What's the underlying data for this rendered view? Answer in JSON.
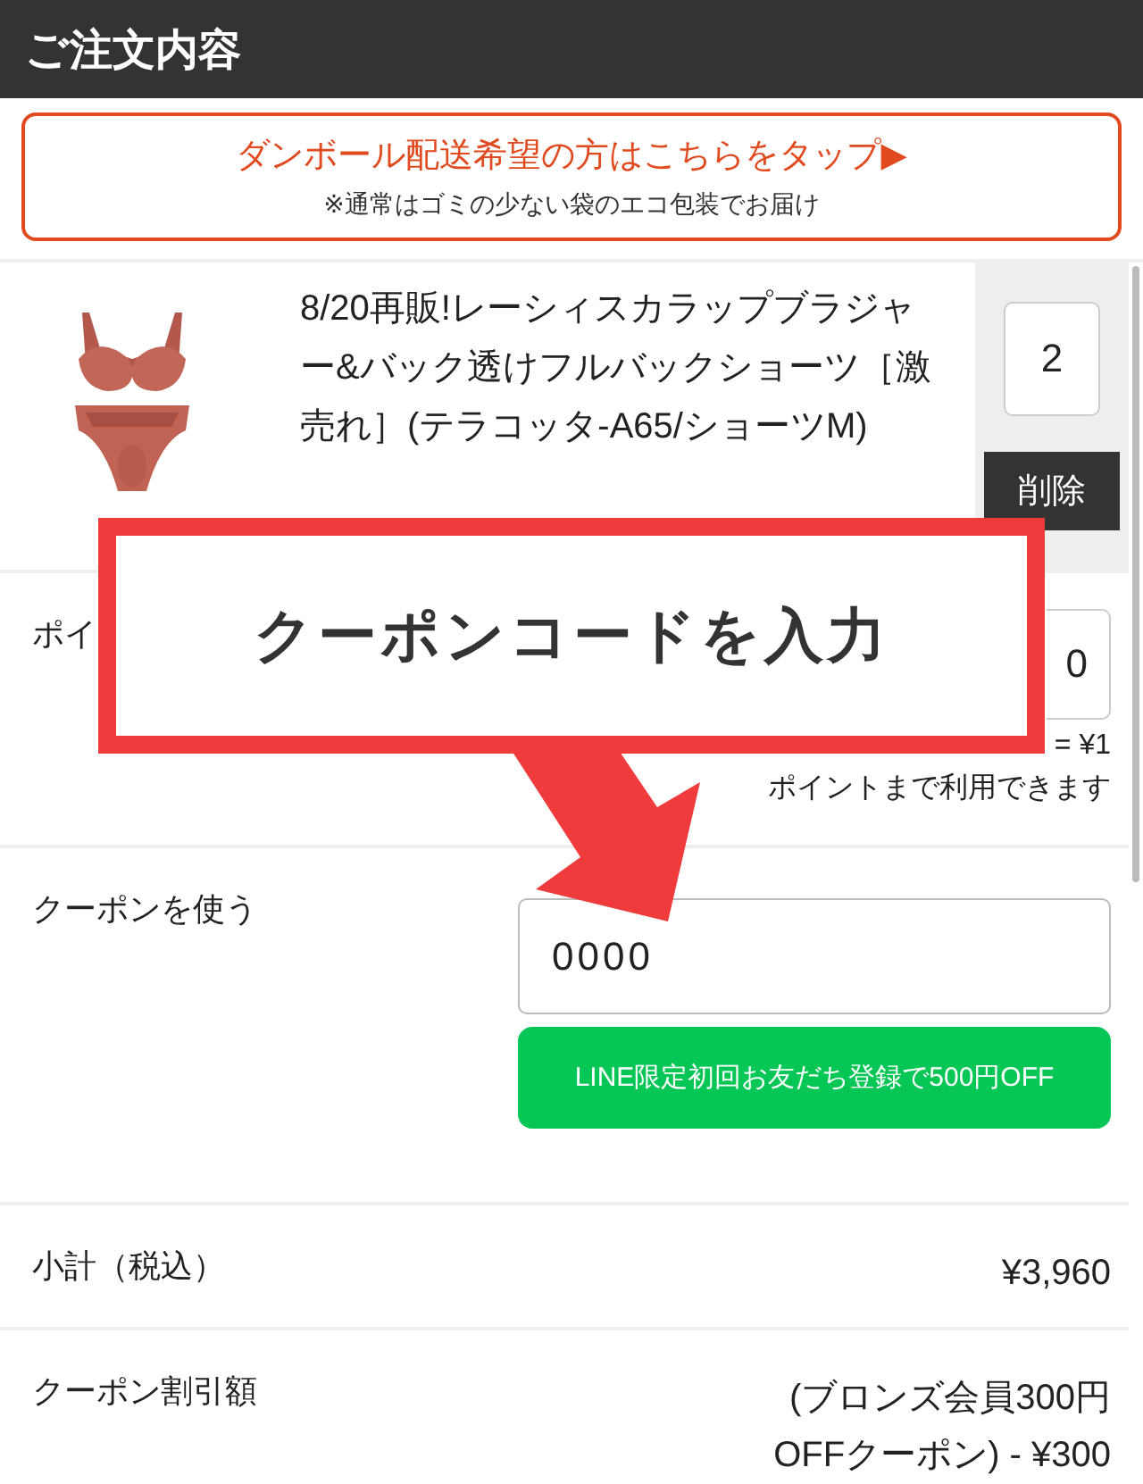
{
  "header": {
    "title": "ご注文内容"
  },
  "banner": {
    "link": "ダンボール配送希望の方はこちらをタップ▶",
    "note": "※通常はゴミの少ない袋のエコ包装でお届け"
  },
  "cart_item": {
    "title": "8/20再販!レーシィスカラップブラジャー&バック透けフルバックショーツ［激売れ］(テラコッタ-A65/ショーツM)",
    "quantity": "2",
    "delete_label": "削除"
  },
  "points": {
    "label": "ポイ",
    "value": "0",
    "rate": "= ¥1",
    "note": "ポイントまで利用できます"
  },
  "coupon": {
    "label": "クーポンを使う",
    "value": "0000",
    "line_button": "LINE限定初回お友だち登録で500円OFF"
  },
  "summary": [
    {
      "label": "小計（税込）",
      "value": "¥3,960"
    },
    {
      "label": "クーポン割引額",
      "value": "(ブロンズ会員300円OFFクーポン) - ¥300"
    }
  ],
  "annotation": {
    "text": "クーポンコードを入力"
  }
}
